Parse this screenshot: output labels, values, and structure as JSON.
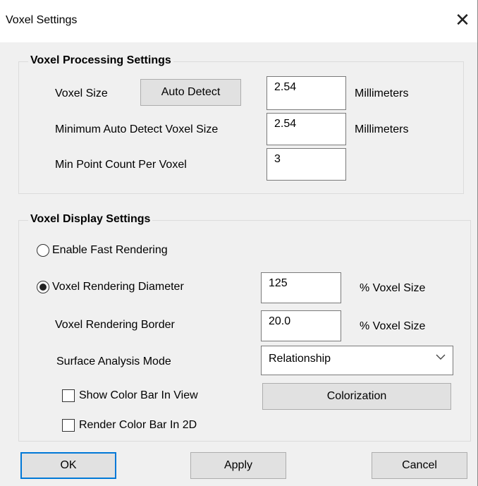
{
  "window": {
    "title": "Voxel Settings",
    "close_glyph": "✕"
  },
  "processing": {
    "group_title": "Voxel Processing Settings",
    "voxel_size_label": "Voxel Size",
    "auto_detect_label": "Auto Detect",
    "voxel_size_value": "2.54",
    "voxel_size_unit": "Millimeters",
    "min_auto_label": "Minimum Auto Detect Voxel Size",
    "min_auto_value": "2.54",
    "min_auto_unit": "Millimeters",
    "min_point_label": "Min Point Count Per Voxel",
    "min_point_value": "3"
  },
  "display": {
    "group_title": "Voxel Display Settings",
    "fast_rendering_label": "Enable Fast Rendering",
    "fast_rendering_selected": false,
    "diameter_label": "Voxel Rendering Diameter",
    "diameter_selected": true,
    "diameter_value": "125",
    "diameter_unit": "% Voxel Size",
    "border_label": "Voxel Rendering Border",
    "border_value": "20.0",
    "border_unit": "% Voxel Size",
    "surface_label": "Surface Analysis Mode",
    "surface_value": "Relationship",
    "show_color_bar_label": "Show Color Bar In View",
    "show_color_bar_checked": false,
    "colorization_label": "Colorization",
    "render_color_bar_label": "Render Color Bar In 2D",
    "render_color_bar_checked": false
  },
  "footer": {
    "ok_label": "OK",
    "apply_label": "Apply",
    "cancel_label": "Cancel"
  },
  "colors": {
    "accent": "#0078d7",
    "dialog_bg": "#f0f0f0",
    "button_bg": "#e1e1e1"
  }
}
